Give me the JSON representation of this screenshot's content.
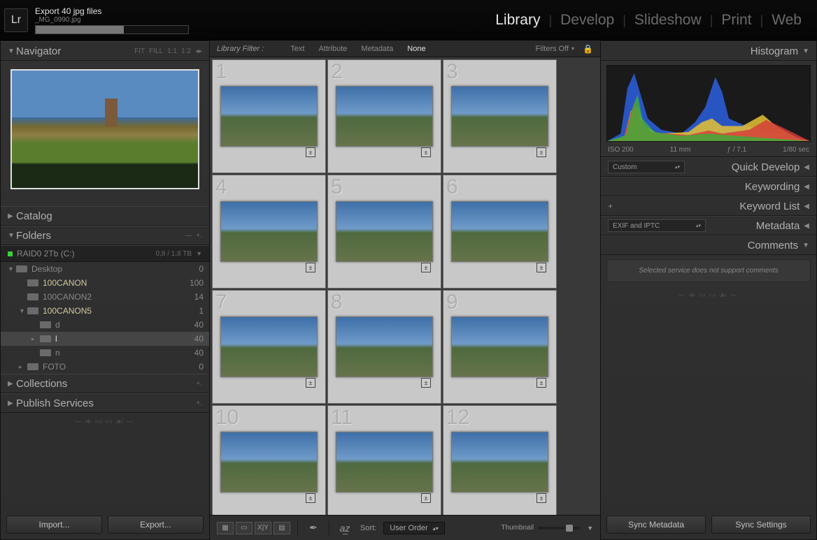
{
  "header": {
    "logo": "Lr",
    "export_title": "Export 40 jpg files",
    "export_sub": "_MG_0990.jpg",
    "progress_pct": 58
  },
  "modules": {
    "items": [
      "Library",
      "Develop",
      "Slideshow",
      "Print",
      "Web"
    ],
    "active": "Library"
  },
  "navigator": {
    "title": "Navigator",
    "modes": [
      "FIT",
      "FILL",
      "1:1",
      "1:2"
    ]
  },
  "left_panels": {
    "catalog": "Catalog",
    "folders": "Folders",
    "volume": {
      "name": "RAID0 2Tb (C:)",
      "stat": "0,8 / 1,8 TB"
    },
    "tree": [
      {
        "label": "Desktop",
        "count": "0",
        "indent": 0,
        "twisty": "▼",
        "highlight": false
      },
      {
        "label": "100CANON",
        "count": "100",
        "indent": 1,
        "twisty": "",
        "highlight": true
      },
      {
        "label": "100CANON2",
        "count": "14",
        "indent": 1,
        "twisty": "",
        "highlight": false
      },
      {
        "label": "100CANON5",
        "count": "1",
        "indent": 1,
        "twisty": "▼",
        "highlight": true
      },
      {
        "label": "d",
        "count": "40",
        "indent": 2,
        "twisty": "",
        "highlight": false
      },
      {
        "label": "l",
        "count": "40",
        "indent": 2,
        "twisty": "▸",
        "highlight": false,
        "selected": true
      },
      {
        "label": "n",
        "count": "40",
        "indent": 2,
        "twisty": "",
        "highlight": false
      },
      {
        "label": "FOTO",
        "count": "0",
        "indent": 1,
        "twisty": "▸",
        "highlight": false
      }
    ],
    "collections": "Collections",
    "publish": "Publish Services",
    "import_btn": "Import...",
    "export_btn": "Export..."
  },
  "filter_bar": {
    "label": "Library Filter :",
    "tabs": [
      "Text",
      "Attribute",
      "Metadata",
      "None"
    ],
    "active": "None",
    "filters_off": "Filters Off"
  },
  "grid": {
    "count": 12
  },
  "toolbar": {
    "sort_label": "Sort:",
    "sort_value": "User Order",
    "slider_label": "Thumbnail"
  },
  "right": {
    "histogram": "Histogram",
    "meta": {
      "iso": "ISO 200",
      "focal": "11 mm",
      "fstop": "ƒ / 7,1",
      "shutter": "1/80 sec"
    },
    "qd_preset": "Custom",
    "quick_develop": "Quick Develop",
    "keywording": "Keywording",
    "keyword_list": "Keyword List",
    "metadata_tab": "Metadata",
    "metadata_preset": "EXIF and IPTC",
    "comments": "Comments",
    "comments_msg": "Selected service does not support comments",
    "sync_meta": "Sync Metadata",
    "sync_settings": "Sync Settings"
  }
}
